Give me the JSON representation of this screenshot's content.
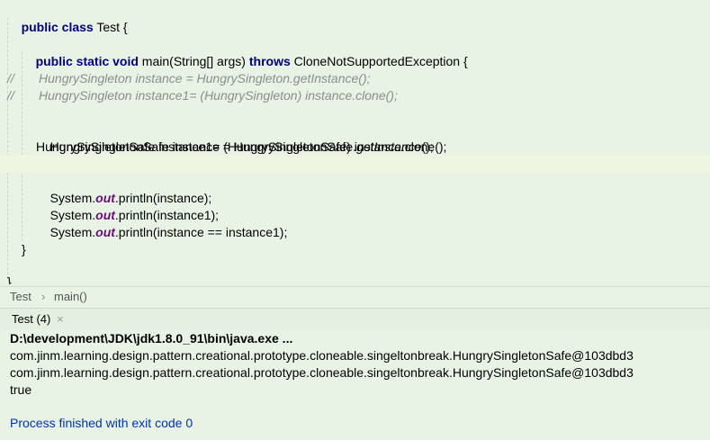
{
  "editor": {
    "lines": [
      {
        "kw1": "public class",
        "text": " Test {"
      },
      {
        "kw1": "public static void",
        "text1": " main(String[] args) ",
        "kw2": "throws",
        "text2": " CloneNotSupportedException {"
      },
      {
        "comment": "//       HungrySingleton instance = HungrySingleton.getInstance();"
      },
      {
        "comment": "//       HungrySingleton instance1= (HungrySingleton) instance.clone();"
      },
      {
        "pre": "HungrySingletonSafe instance = HungrySingletonSafe.",
        "italic": "getInstance",
        "post": "();"
      },
      {
        "text": "HungrySingletonSafe instance1= (HungrySingletonSafe) instance.clone();"
      },
      {
        "pre": "System.",
        "static": "out",
        "post": ".println(instance);"
      },
      {
        "pre": "System.",
        "static": "out",
        "post": ".println(instance1);"
      },
      {
        "pre": "System.",
        "static": "out",
        "post": ".println(instance == instance1);"
      },
      {
        "text": "}"
      },
      {
        "text": "}"
      }
    ]
  },
  "breadcrumb": {
    "items": [
      "Test",
      "main()"
    ],
    "separator": "›"
  },
  "run_tab": {
    "label": "Test (4)",
    "close": "×"
  },
  "console": {
    "command": "D:\\development\\JDK\\jdk1.8.0_91\\bin\\java.exe ...",
    "output": [
      "com.jinm.learning.design.pattern.creational.prototype.cloneable.singeltonbreak.HungrySingletonSafe@103dbd3",
      "com.jinm.learning.design.pattern.creational.prototype.cloneable.singeltonbreak.HungrySingletonSafe@103dbd3",
      "true"
    ],
    "exit": "Process finished with exit code 0"
  }
}
